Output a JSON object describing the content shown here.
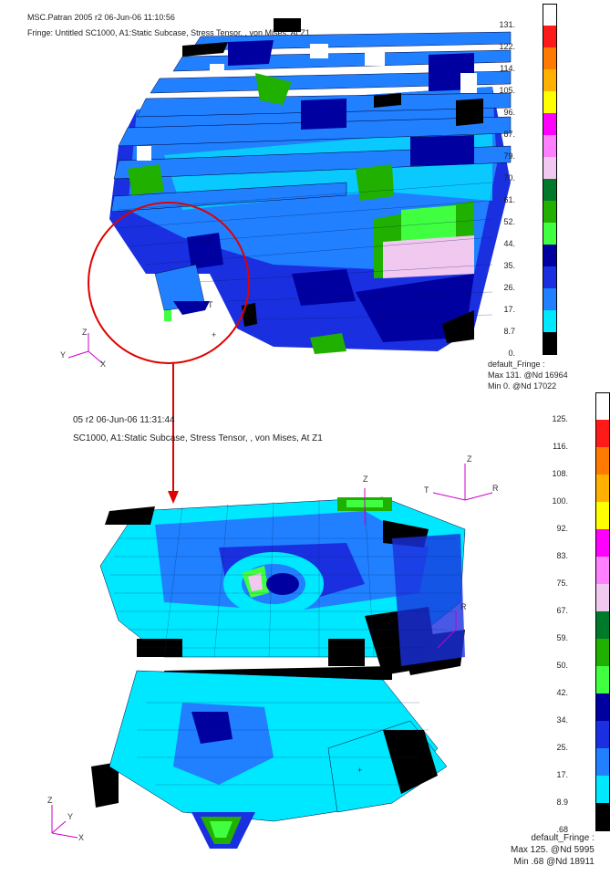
{
  "top": {
    "header_line1": "MSC.Patran 2005 r2 06-Jun-06 11:10:56",
    "header_line2": "Fringe: Untitled SC1000, A1:Static Subcase, Stress Tensor, , von Mises, At Z1",
    "legend_values": [
      "131.",
      "122.",
      "114.",
      "105.",
      "96.",
      "87.",
      "79.",
      "70.",
      "61.",
      "52.",
      "44.",
      "35.",
      "26.",
      "17.",
      "8.7",
      "0."
    ],
    "fringe_title": "default_Fringe :",
    "fringe_max": "Max 131. @Nd 16964",
    "fringe_min": "Min 0. @Nd 17022",
    "axis": {
      "z": "Z",
      "y": "Y",
      "x": "X"
    },
    "probe_label": "T"
  },
  "bottom": {
    "header_line1": "05 r2 06-Jun-06 11:31:44",
    "header_line2": "SC1000, A1:Static Subcase, Stress Tensor, , von Mises, At Z1",
    "legend_values": [
      "125.",
      "116.",
      "108.",
      "100.",
      "92.",
      "83.",
      "75.",
      "67.",
      "59.",
      "50.",
      "42.",
      "34.",
      "25.",
      "17.",
      "8.9",
      ".68"
    ],
    "fringe_title": "default_Fringe :",
    "fringe_max": "Max 125. @Nd 5995",
    "fringe_min": "Min .68 @Nd 18911",
    "axis": {
      "z": "Z",
      "y": "Y",
      "x": "X"
    },
    "coord_labels": {
      "z": "Z",
      "t": "T",
      "r": "R",
      "r2": "R",
      "t2": "T"
    }
  },
  "colors": {
    "scale": [
      "#ffffff",
      "#ff1a1a",
      "#ff7a00",
      "#ffb000",
      "#ffff00",
      "#ff00ff",
      "#ff80ff",
      "#f0c8f0",
      "#007a2a",
      "#20b000",
      "#40ff40",
      "#0000a0",
      "#1a30e0",
      "#2080ff",
      "#00e8ff",
      "#000000"
    ],
    "callout": "#e00000"
  }
}
